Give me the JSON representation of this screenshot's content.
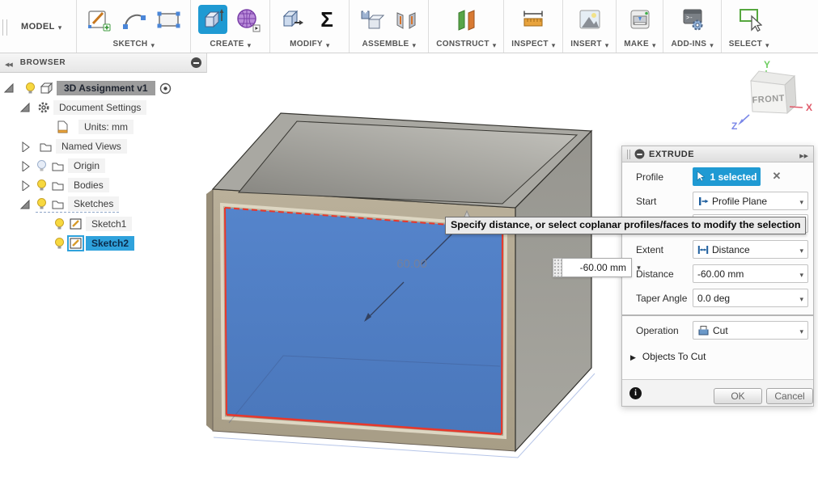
{
  "toolbar": {
    "model_label": "MODEL",
    "groups": [
      {
        "label": "SKETCH"
      },
      {
        "label": "CREATE"
      },
      {
        "label": "MODIFY"
      },
      {
        "label": "ASSEMBLE"
      },
      {
        "label": "CONSTRUCT"
      },
      {
        "label": "INSPECT"
      },
      {
        "label": "INSERT"
      },
      {
        "label": "MAKE"
      },
      {
        "label": "ADD-INS"
      },
      {
        "label": "SELECT"
      }
    ]
  },
  "browser": {
    "title": "BROWSER",
    "items": [
      {
        "label": "3D Assignment v1",
        "state": "selected"
      },
      {
        "label": "Document Settings",
        "state": "expanded"
      },
      {
        "label": "Units: mm",
        "state": "normal"
      },
      {
        "label": "Named Views",
        "state": "collapsed"
      },
      {
        "label": "Origin",
        "state": "collapsed-hidden"
      },
      {
        "label": "Bodies",
        "state": "collapsed-visible"
      },
      {
        "label": "Sketches",
        "state": "expanded"
      },
      {
        "label": "Sketch1",
        "state": "visible"
      },
      {
        "label": "Sketch2",
        "state": "selected"
      }
    ]
  },
  "viewcube": {
    "front_label": "FRONT",
    "axis_x": "X",
    "axis_y": "Y",
    "axis_z": "Z"
  },
  "canvas": {
    "dimension_label": "60.00",
    "distance_input_value": "-60.00 mm",
    "tooltip": "Specify distance, or select coplanar profiles/faces to modify the selection"
  },
  "dialog": {
    "title": "EXTRUDE",
    "profile_label": "Profile",
    "profile_value": "1 selected",
    "start_label": "Start",
    "start_value": "Profile Plane",
    "extent_label": "Extent",
    "extent_value": "Distance",
    "distance_label": "Distance",
    "distance_value": "-60.00 mm",
    "taper_label": "Taper Angle",
    "taper_value": "0.0 deg",
    "operation_label": "Operation",
    "objects_label": "Objects To Cut",
    "operation_value": "Cut",
    "ok_label": "OK",
    "cancel_label": "Cancel"
  },
  "colors": {
    "accent_blue": "#1f9ad3",
    "selected_face_blue": "#4e7fc9",
    "highlight_red": "#e8382b",
    "body_tan": "#b2a892",
    "body_gray": "#9b9a94"
  }
}
